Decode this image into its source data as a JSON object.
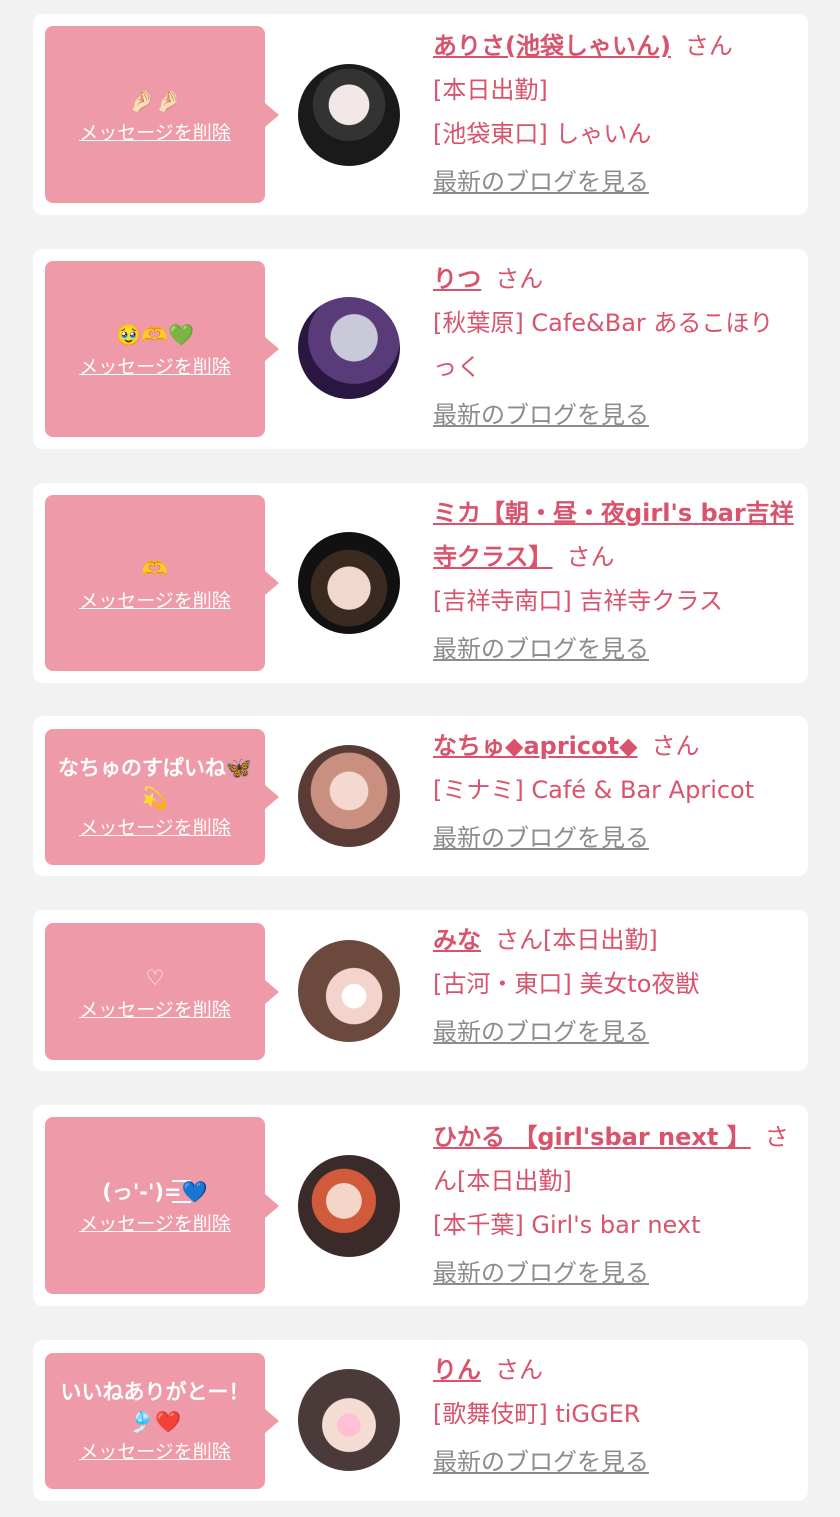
{
  "delete_label": "メッセージを削除",
  "san_label": "さん",
  "blog_label": "最新のブログを見る",
  "items": [
    {
      "message": "🤌🏻🤌🏻",
      "name": "ありさ(池袋しゃいん)",
      "after_san": "",
      "status": "[本日出勤]",
      "shop": "[池袋東口] しゃいん"
    },
    {
      "message": "🥹🫶💚",
      "name": "りつ",
      "after_san": "",
      "status": "",
      "shop": "[秋葉原] Cafe&Bar あるこほりっく"
    },
    {
      "message": "🫶",
      "name": "ミカ【朝・昼・夜girl's bar吉祥寺クラス】",
      "after_san": "",
      "status": "",
      "shop": "[吉祥寺南口] 吉祥寺クラス"
    },
    {
      "message": "なちゅのすぱいね🦋💫",
      "name": "なちゅ◆apricot◆",
      "after_san": "",
      "status": "",
      "shop": "[ミナミ] Café & Bar Apricot"
    },
    {
      "message": "♡",
      "name": "みな",
      "after_san": "[本日出勤]",
      "status": "",
      "shop": "[古河・東口] 美女to夜獣"
    },
    {
      "message": "(っ'-')=͟͟͞͞💙",
      "name": "ひかる 【girl'sbar next 】",
      "after_san": "[本日出勤]",
      "status": "",
      "shop": "[本千葉] Girl's bar next"
    },
    {
      "message": "いいねありがとー！🎐❤️",
      "name": "りん",
      "after_san": "",
      "status": "",
      "shop": "[歌舞伎町] tiGGER"
    }
  ]
}
